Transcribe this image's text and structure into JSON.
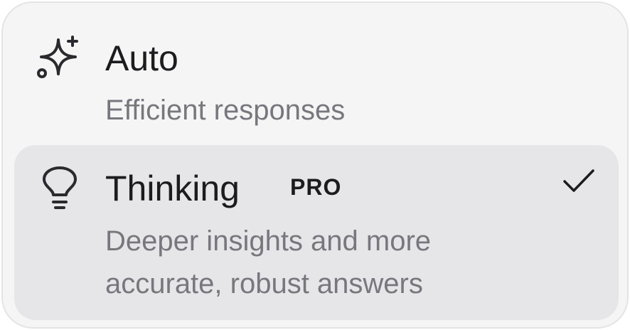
{
  "options": [
    {
      "icon": "sparkle-plus-icon",
      "title": "Auto",
      "description_lines": [
        "Efficient responses"
      ],
      "selected": false
    },
    {
      "icon": "lightbulb-icon",
      "title": "Thinking",
      "badge": "PRO",
      "description_lines": [
        "Deeper insights and more",
        "accurate, robust answers"
      ],
      "selected": true
    }
  ],
  "colors": {
    "menu_background": "#f5f5f6",
    "selected_background": "#e6e6e9",
    "title_text": "#1c1c1f",
    "description_text": "#77777d"
  }
}
